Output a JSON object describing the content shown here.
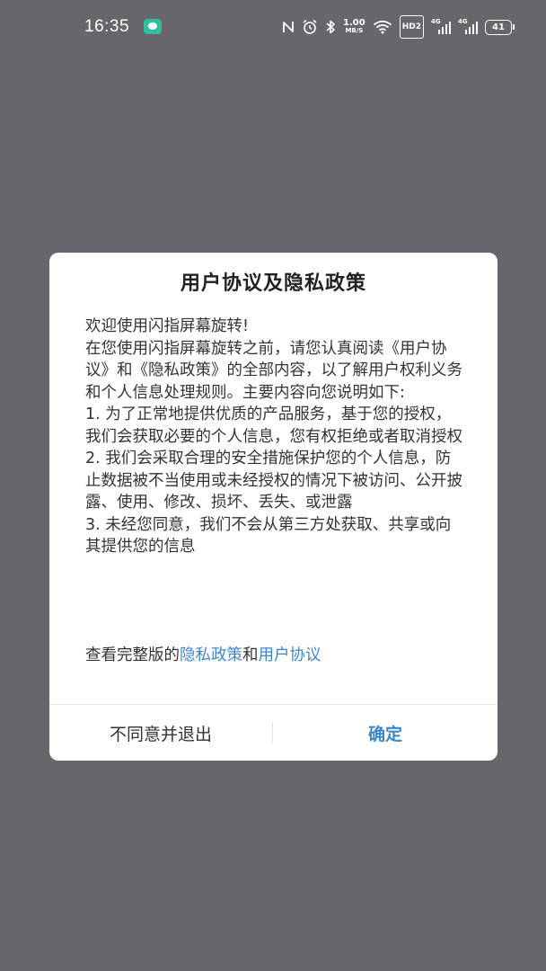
{
  "status_bar": {
    "time": "16:35",
    "net_speed_value": "1.00",
    "net_speed_unit": "MB/S",
    "hd_badge": "HD2",
    "signal1_tag": "4G",
    "signal2_tag": "4G",
    "battery": "41",
    "icons": [
      "app-notification-icon",
      "nfc-icon",
      "alarm-icon",
      "bluetooth-icon",
      "wifi-icon",
      "signal-icon",
      "battery-icon"
    ]
  },
  "dialog": {
    "title": "用户协议及隐私政策",
    "paragraphs": [
      "欢迎使用闪指屏幕旋转!",
      "在您使用闪指屏幕旋转之前，请您认真阅读《用户协议》和《隐私政策》的全部内容，以了解用户权利义务和个人信息处理规则。主要内容向您说明如下:",
      "1. 为了正常地提供优质的产品服务，基于您的授权，我们会获取必要的个人信息，您有权拒绝或者取消授权",
      "2. 我们会采取合理的安全措施保护您的个人信息，防止数据被不当使用或未经授权的情况下被访问、公开披露、使用、修改、损坏、丢失、或泄露",
      "3. 未经您同意，我们不会从第三方处获取、共享或向其提供您的信息"
    ],
    "links_prefix": "查看完整版的",
    "privacy_link": "隐私政策",
    "links_and": "和",
    "agreement_link": "用户协议",
    "decline_button": "不同意并退出",
    "confirm_button": "确定"
  },
  "colors": {
    "backdrop": "#67666a",
    "link": "#3f86c6",
    "notification_app": "#2fbf9a"
  }
}
